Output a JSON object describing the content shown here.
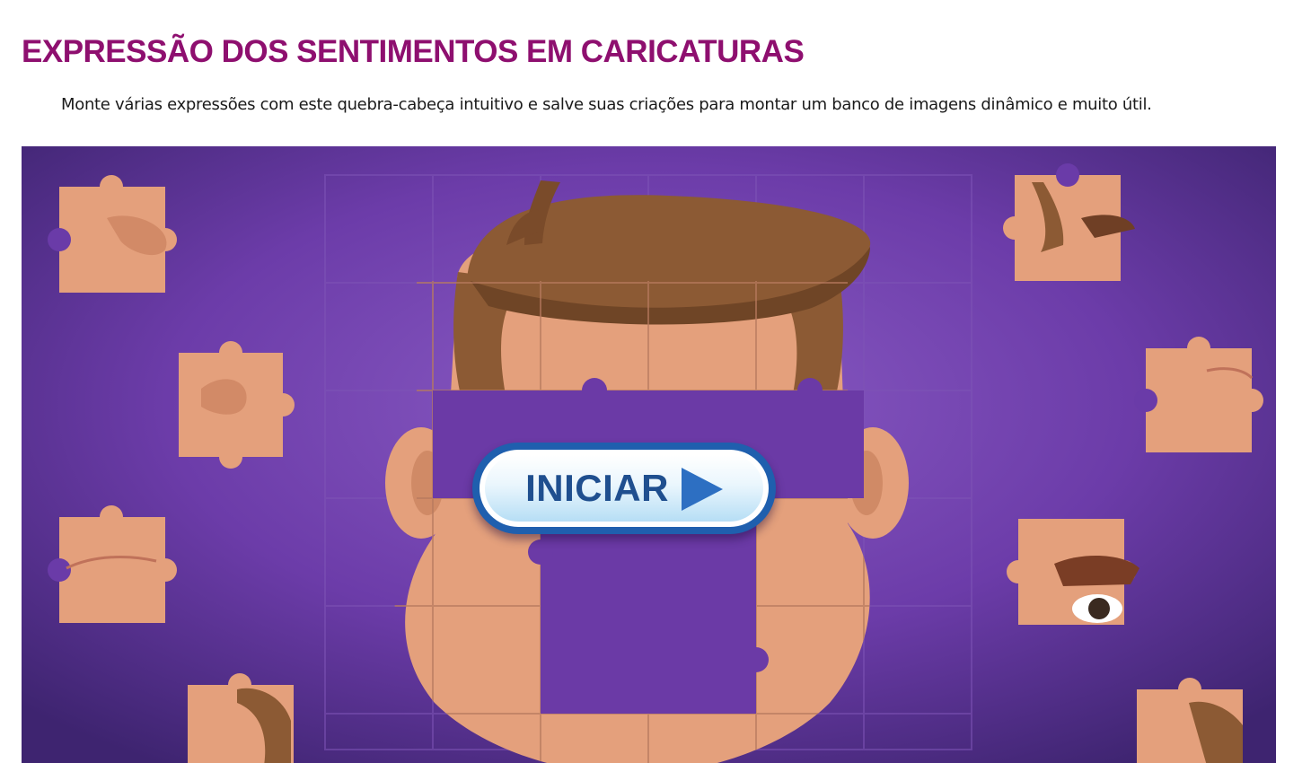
{
  "page": {
    "title": "EXPRESSÃO DOS SENTIMENTOS EM CARICATURAS",
    "description": "Monte várias expressões com este quebra-cabeça intuitivo e salve suas criações para montar um banco de imagens dinâmico e muito útil."
  },
  "game": {
    "start_label": "INICIAR",
    "start_icon": "play-icon",
    "scene": "puzzle-caricature-face",
    "colors": {
      "title": "#8e0f6f",
      "background": "#6a3ba8",
      "missing_slot": "#6b3aa6",
      "skin": "#e4a07c",
      "hair": "#8c5a34",
      "button_border": "#1f5fae",
      "button_text": "#1f4f8f"
    }
  }
}
